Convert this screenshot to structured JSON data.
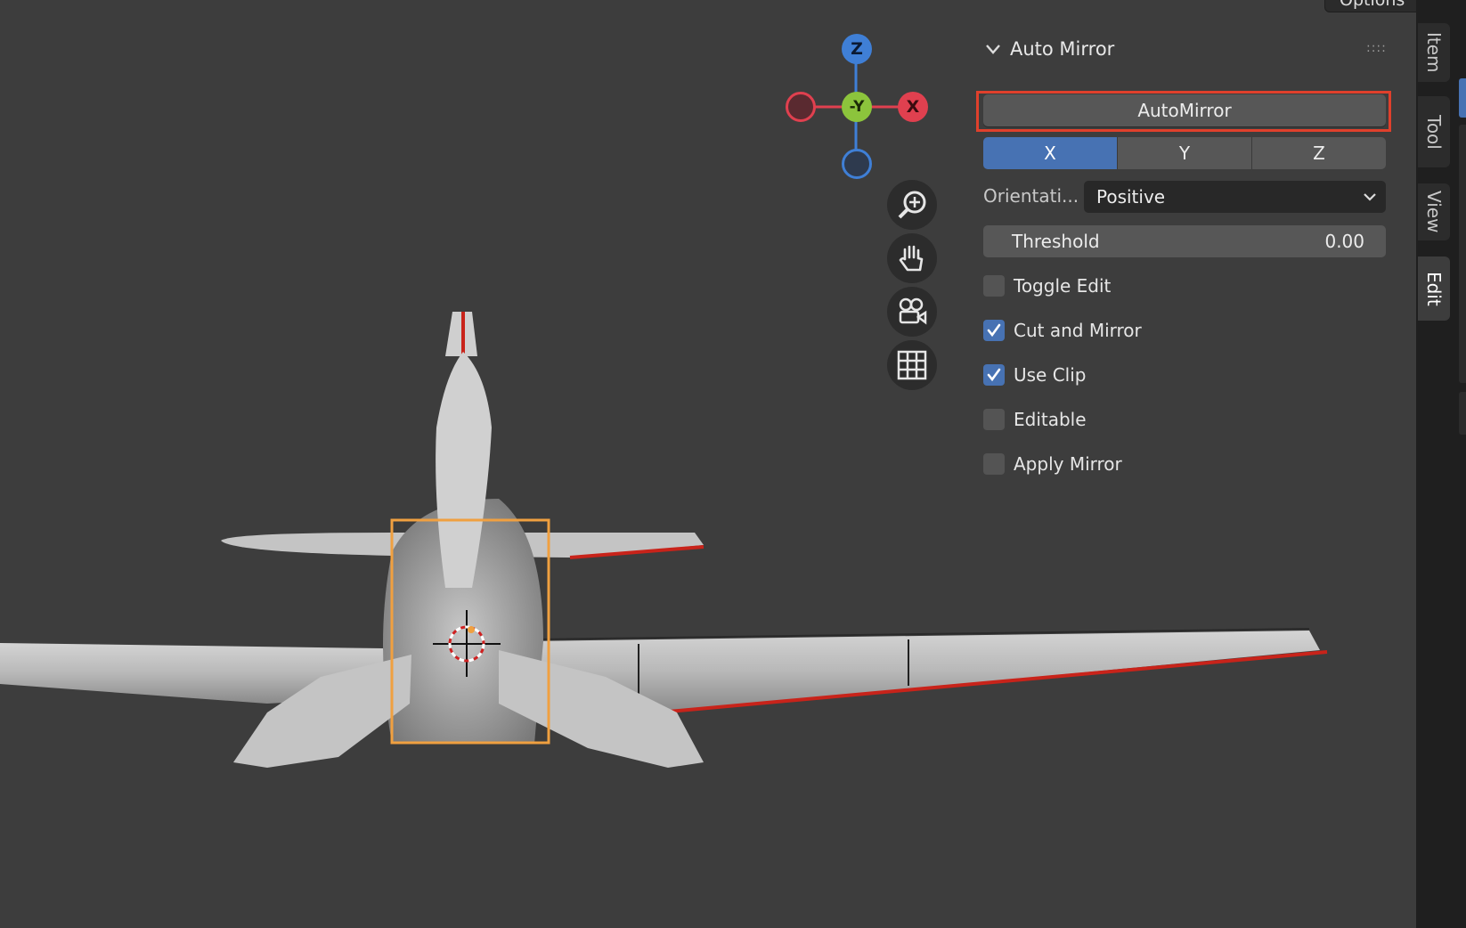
{
  "header": {
    "options_label": "Options"
  },
  "gizmo": {
    "z_label": "Z",
    "y_label": "-Y",
    "x_label": "X"
  },
  "nav_tools": [
    "zoom-icon",
    "hand-pan-icon",
    "camera-icon",
    "grid-ortho-icon"
  ],
  "panel": {
    "title": "Auto Mirror",
    "automirror_button": "AutoMirror",
    "axes": [
      {
        "label": "X",
        "active": true
      },
      {
        "label": "Y",
        "active": false
      },
      {
        "label": "Z",
        "active": false
      }
    ],
    "orientation_label": "Orientati...",
    "orientation_value": "Positive",
    "threshold_label": "Threshold",
    "threshold_value": "0.00",
    "checkboxes": [
      {
        "label": "Toggle Edit",
        "checked": false
      },
      {
        "label": "Cut and Mirror",
        "checked": true
      },
      {
        "label": "Use Clip",
        "checked": true
      },
      {
        "label": "Editable",
        "checked": false
      },
      {
        "label": "Apply Mirror",
        "checked": false
      }
    ]
  },
  "tabs": [
    {
      "label": "Item",
      "active": false
    },
    {
      "label": "Tool",
      "active": false
    },
    {
      "label": "View",
      "active": false
    },
    {
      "label": "Edit",
      "active": true
    }
  ],
  "colors": {
    "viewport_bg": "#3d3d3d",
    "accent_blue": "#4772b3",
    "highlight_red": "#e0402c",
    "selection_orange": "#f0a040",
    "axis_x": "#e0404f",
    "axis_y": "#8cc43c",
    "axis_z": "#3f7fd6"
  }
}
